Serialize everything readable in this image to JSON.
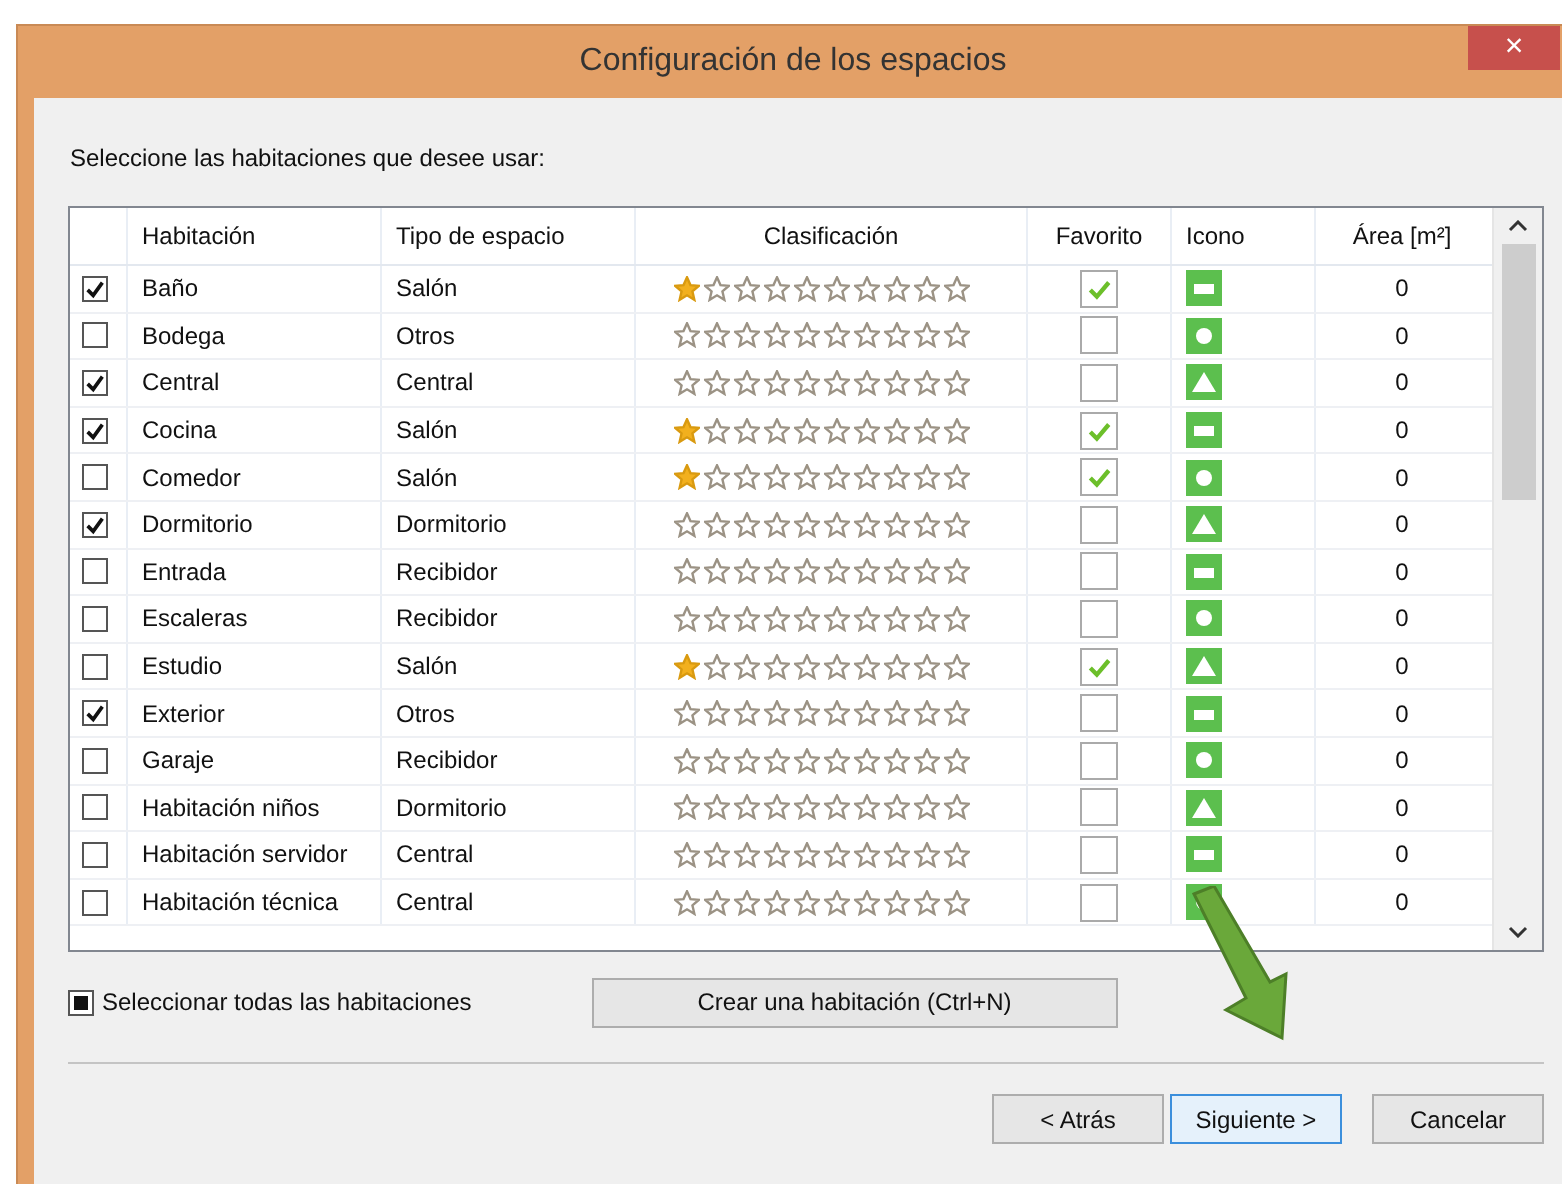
{
  "window": {
    "title": "Configuración de los espacios",
    "close": "×"
  },
  "prompt": "Seleccione las habitaciones que desee usar:",
  "table": {
    "columns": [
      "Habitación",
      "Tipo de espacio",
      "Clasificación",
      "Favorito",
      "Icono",
      "Área [m²]"
    ],
    "rows": [
      {
        "checked": true,
        "name": "Baño",
        "type": "Salón",
        "stars": 1,
        "favorite": true,
        "area": "0"
      },
      {
        "checked": false,
        "name": "Bodega",
        "type": "Otros",
        "stars": 0,
        "favorite": false,
        "area": "0"
      },
      {
        "checked": true,
        "name": "Central",
        "type": "Central",
        "stars": 0,
        "favorite": false,
        "area": "0"
      },
      {
        "checked": true,
        "name": "Cocina",
        "type": "Salón",
        "stars": 1,
        "favorite": true,
        "area": "0"
      },
      {
        "checked": false,
        "name": "Comedor",
        "type": "Salón",
        "stars": 1,
        "favorite": true,
        "area": "0"
      },
      {
        "checked": true,
        "name": "Dormitorio",
        "type": "Dormitorio",
        "stars": 0,
        "favorite": false,
        "area": "0"
      },
      {
        "checked": false,
        "name": "Entrada",
        "type": "Recibidor",
        "stars": 0,
        "favorite": false,
        "area": "0"
      },
      {
        "checked": false,
        "name": "Escaleras",
        "type": "Recibidor",
        "stars": 0,
        "favorite": false,
        "area": "0"
      },
      {
        "checked": false,
        "name": "Estudio",
        "type": "Salón",
        "stars": 1,
        "favorite": true,
        "area": "0"
      },
      {
        "checked": true,
        "name": "Exterior",
        "type": "Otros",
        "stars": 0,
        "favorite": false,
        "area": "0"
      },
      {
        "checked": false,
        "name": "Garaje",
        "type": "Recibidor",
        "stars": 0,
        "favorite": false,
        "area": "0"
      },
      {
        "checked": false,
        "name": "Habitación niños",
        "type": "Dormitorio",
        "stars": 0,
        "favorite": false,
        "area": "0"
      },
      {
        "checked": false,
        "name": "Habitación servidor",
        "type": "Central",
        "stars": 0,
        "favorite": false,
        "area": "0"
      },
      {
        "checked": false,
        "name": "Habitación técnica",
        "type": "Central",
        "stars": 0,
        "favorite": false,
        "area": "0"
      }
    ]
  },
  "select_all": {
    "label": "Seleccionar todas las habitaciones",
    "indeterminate": true
  },
  "create_button": "Crear una habitación (Ctrl+N)",
  "buttons": [
    {
      "label": "< Atrás",
      "focused": false
    },
    {
      "label": "Siguiente >",
      "focused": true
    },
    {
      "label": "Cancelar",
      "focused": false
    }
  ]
}
